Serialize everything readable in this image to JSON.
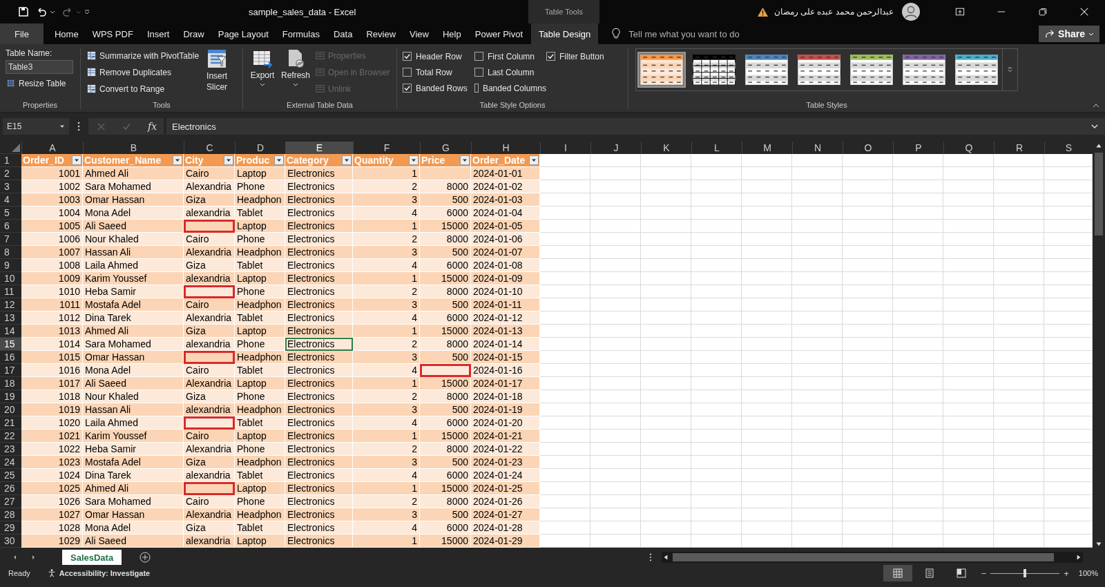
{
  "window": {
    "title": "sample_sales_data  -  Excel",
    "context_label": "Table Tools",
    "user": "عبدالرحمن محمد عبده على رمضان"
  },
  "menu_tabs": [
    {
      "label": "File",
      "selected": false
    },
    {
      "label": "Home",
      "selected": false
    },
    {
      "label": "WPS PDF",
      "selected": false
    },
    {
      "label": "Insert",
      "selected": false
    },
    {
      "label": "Draw",
      "selected": false
    },
    {
      "label": "Page Layout",
      "selected": false
    },
    {
      "label": "Formulas",
      "selected": false
    },
    {
      "label": "Data",
      "selected": false
    },
    {
      "label": "Review",
      "selected": false
    },
    {
      "label": "View",
      "selected": false
    },
    {
      "label": "Help",
      "selected": false
    },
    {
      "label": "Power Pivot",
      "selected": false
    },
    {
      "label": "Table Design",
      "selected": true
    }
  ],
  "tell_me": {
    "placeholder": "Tell me what you want to do"
  },
  "share": "Share",
  "ribbon": {
    "properties": {
      "label": "Table Name:",
      "table_name": "Table3",
      "resize": "Resize Table",
      "group": "Properties"
    },
    "tools": {
      "items": [
        "Summarize with PivotTable",
        "Remove Duplicates",
        "Convert to Range"
      ],
      "slicer": "Insert Slicer",
      "group": "Tools"
    },
    "external": {
      "export": "Export",
      "refresh": "Refresh",
      "items": [
        {
          "label": "Properties",
          "disabled": true
        },
        {
          "label": "Open in Browser",
          "disabled": true
        },
        {
          "label": "Unlink",
          "disabled": true
        }
      ],
      "group": "External Table Data"
    },
    "style_options": {
      "options": [
        {
          "label": "Header Row",
          "checked": true
        },
        {
          "label": "Total Row",
          "checked": false
        },
        {
          "label": "Banded Rows",
          "checked": true
        },
        {
          "label": "First Column",
          "checked": false
        },
        {
          "label": "Last Column",
          "checked": false
        },
        {
          "label": "Banded Columns",
          "checked": false
        },
        {
          "label": "Filter Button",
          "checked": true
        }
      ],
      "group": "Table Style Options"
    },
    "styles": {
      "swatches": [
        {
          "kind": "tinted",
          "color": "#f79646",
          "selected": true
        },
        {
          "kind": "grid",
          "color": "#000000",
          "selected": false
        },
        {
          "kind": "plain",
          "color": "#4f81bd",
          "selected": false
        },
        {
          "kind": "plain",
          "color": "#c0504d",
          "selected": false
        },
        {
          "kind": "plain",
          "color": "#9bbb59",
          "selected": false
        },
        {
          "kind": "plain",
          "color": "#8064a2",
          "selected": false
        },
        {
          "kind": "plain",
          "color": "#4bacc6",
          "selected": false
        }
      ],
      "group": "Table Styles"
    }
  },
  "formula_bar": {
    "name_box": "E15",
    "fx_label": "fx",
    "value": "Electronics"
  },
  "sheet": {
    "columns": [
      {
        "letter": "A",
        "selected": false
      },
      {
        "letter": "B",
        "selected": false
      },
      {
        "letter": "C",
        "selected": false
      },
      {
        "letter": "D",
        "selected": false
      },
      {
        "letter": "E",
        "selected": true
      },
      {
        "letter": "F",
        "selected": false
      },
      {
        "letter": "G",
        "selected": false
      },
      {
        "letter": "H",
        "selected": false
      },
      {
        "letter": "I",
        "selected": false
      },
      {
        "letter": "J",
        "selected": false
      },
      {
        "letter": "K",
        "selected": false
      },
      {
        "letter": "L",
        "selected": false
      },
      {
        "letter": "M",
        "selected": false
      },
      {
        "letter": "N",
        "selected": false
      },
      {
        "letter": "O",
        "selected": false
      },
      {
        "letter": "P",
        "selected": false
      },
      {
        "letter": "Q",
        "selected": false
      },
      {
        "letter": "R",
        "selected": false
      },
      {
        "letter": "S",
        "selected": false
      }
    ],
    "header_row": "1",
    "headers": [
      {
        "label": "Order_ID",
        "kind": "number"
      },
      {
        "label": "Customer_Name",
        "kind": "text"
      },
      {
        "label": "City",
        "kind": "text"
      },
      {
        "label": "Produc",
        "kind": "text"
      },
      {
        "label": "Category",
        "kind": "text"
      },
      {
        "label": "Quantity",
        "kind": "number"
      },
      {
        "label": "Price",
        "kind": "number"
      },
      {
        "label": "Order_Date",
        "kind": "text"
      }
    ],
    "rows": [
      {
        "n": "2",
        "selected": false,
        "cells": [
          "1001",
          "Ahmed Ali",
          "Cairo",
          "Laptop",
          "Electronics",
          "1",
          null,
          "2024-01-01"
        ]
      },
      {
        "n": "3",
        "selected": false,
        "cells": [
          "1002",
          "Sara Mohamed",
          "Alexandria",
          "Phone",
          "Electronics",
          "2",
          "8000",
          "2024-01-02"
        ]
      },
      {
        "n": "4",
        "selected": false,
        "cells": [
          "1003",
          "Omar Hassan",
          "Giza",
          "Headphon",
          "Electronics",
          "3",
          "500",
          "2024-01-03"
        ]
      },
      {
        "n": "5",
        "selected": false,
        "cells": [
          "1004",
          "Mona Adel",
          "alexandria",
          "Tablet",
          "Electronics",
          "4",
          "6000",
          "2024-01-04"
        ]
      },
      {
        "n": "6",
        "selected": false,
        "cells": [
          "1005",
          "Ali Saeed",
          {
            "flagged": true
          },
          "Laptop",
          "Electronics",
          "1",
          "15000",
          "2024-01-05"
        ]
      },
      {
        "n": "7",
        "selected": false,
        "cells": [
          "1006",
          "Nour Khaled",
          "Cairo",
          "Phone",
          "Electronics",
          "2",
          "8000",
          "2024-01-06"
        ]
      },
      {
        "n": "8",
        "selected": false,
        "cells": [
          "1007",
          "Hassan Ali",
          "Alexandria",
          "Headphon",
          "Electronics",
          "3",
          "500",
          "2024-01-07"
        ]
      },
      {
        "n": "9",
        "selected": false,
        "cells": [
          "1008",
          "Laila Ahmed",
          "Giza",
          "Tablet",
          "Electronics",
          "4",
          "6000",
          "2024-01-08"
        ]
      },
      {
        "n": "10",
        "selected": false,
        "cells": [
          "1009",
          "Karim Youssef",
          "alexandria",
          "Laptop",
          "Electronics",
          "1",
          "15000",
          "2024-01-09"
        ]
      },
      {
        "n": "11",
        "selected": false,
        "cells": [
          "1010",
          "Heba Samir",
          {
            "flagged": true
          },
          "Phone",
          "Electronics",
          "2",
          "8000",
          "2024-01-10"
        ]
      },
      {
        "n": "12",
        "selected": false,
        "cells": [
          "1011",
          "Mostafa Adel",
          "Cairo",
          "Headphon",
          "Electronics",
          "3",
          "500",
          "2024-01-11"
        ]
      },
      {
        "n": "13",
        "selected": false,
        "cells": [
          "1012",
          "Dina Tarek",
          "Alexandria",
          "Tablet",
          "Electronics",
          "4",
          "6000",
          "2024-01-12"
        ]
      },
      {
        "n": "14",
        "selected": false,
        "cells": [
          "1013",
          "Ahmed Ali",
          "Giza",
          "Laptop",
          "Electronics",
          "1",
          "15000",
          "2024-01-13"
        ]
      },
      {
        "n": "15",
        "selected": true,
        "cells": [
          "1014",
          "Sara Mohamed",
          "alexandria",
          "Phone",
          "Electronics",
          "2",
          "8000",
          "2024-01-14"
        ]
      },
      {
        "n": "16",
        "selected": false,
        "cells": [
          "1015",
          "Omar Hassan",
          {
            "flagged": true
          },
          "Headphon",
          "Electronics",
          "3",
          "500",
          "2024-01-15"
        ]
      },
      {
        "n": "17",
        "selected": false,
        "cells": [
          "1016",
          "Mona Adel",
          "Cairo",
          "Tablet",
          "Electronics",
          "4",
          {
            "flagged": true
          },
          "2024-01-16"
        ]
      },
      {
        "n": "18",
        "selected": false,
        "cells": [
          "1017",
          "Ali Saeed",
          "Alexandria",
          "Laptop",
          "Electronics",
          "1",
          "15000",
          "2024-01-17"
        ]
      },
      {
        "n": "19",
        "selected": false,
        "cells": [
          "1018",
          "Nour Khaled",
          "Giza",
          "Phone",
          "Electronics",
          "2",
          "8000",
          "2024-01-18"
        ]
      },
      {
        "n": "20",
        "selected": false,
        "cells": [
          "1019",
          "Hassan Ali",
          "alexandria",
          "Headphon",
          "Electronics",
          "3",
          "500",
          "2024-01-19"
        ]
      },
      {
        "n": "21",
        "selected": false,
        "cells": [
          "1020",
          "Laila Ahmed",
          {
            "flagged": true
          },
          "Tablet",
          "Electronics",
          "4",
          "6000",
          "2024-01-20"
        ]
      },
      {
        "n": "22",
        "selected": false,
        "cells": [
          "1021",
          "Karim Youssef",
          "Cairo",
          "Laptop",
          "Electronics",
          "1",
          "15000",
          "2024-01-21"
        ]
      },
      {
        "n": "23",
        "selected": false,
        "cells": [
          "1022",
          "Heba Samir",
          "Alexandria",
          "Phone",
          "Electronics",
          "2",
          "8000",
          "2024-01-22"
        ]
      },
      {
        "n": "24",
        "selected": false,
        "cells": [
          "1023",
          "Mostafa Adel",
          "Giza",
          "Headphon",
          "Electronics",
          "3",
          "500",
          "2024-01-23"
        ]
      },
      {
        "n": "25",
        "selected": false,
        "cells": [
          "1024",
          "Dina Tarek",
          "alexandria",
          "Tablet",
          "Electronics",
          "4",
          "6000",
          "2024-01-24"
        ]
      },
      {
        "n": "26",
        "selected": false,
        "cells": [
          "1025",
          "Ahmed Ali",
          {
            "flagged": true
          },
          "Laptop",
          "Electronics",
          "1",
          "15000",
          "2024-01-25"
        ]
      },
      {
        "n": "27",
        "selected": false,
        "cells": [
          "1026",
          "Sara Mohamed",
          "Cairo",
          "Phone",
          "Electronics",
          "2",
          "8000",
          "2024-01-26"
        ]
      },
      {
        "n": "28",
        "selected": false,
        "cells": [
          "1027",
          "Omar Hassan",
          "Alexandria",
          "Headphon",
          "Electronics",
          "3",
          "500",
          "2024-01-27"
        ]
      },
      {
        "n": "29",
        "selected": false,
        "cells": [
          "1028",
          "Mona Adel",
          "Giza",
          "Tablet",
          "Electronics",
          "4",
          "6000",
          "2024-01-28"
        ]
      },
      {
        "n": "30",
        "selected": false,
        "cells": [
          "1029",
          "Ali Saeed",
          "alexandria",
          "Laptop",
          "Electronics",
          "1",
          "15000",
          "2024-01-29"
        ]
      }
    ]
  },
  "sheet_tabs": [
    {
      "label": "SalesData",
      "selected": true
    }
  ],
  "status_bar": {
    "ready": "Ready",
    "accessibility": "Accessibility: Investigate",
    "views": [
      {
        "kind": "normal",
        "selected": true
      },
      {
        "kind": "page-layout",
        "selected": false
      },
      {
        "kind": "page-break",
        "selected": false
      }
    ],
    "zoom_out": "−",
    "zoom_slider": {
      "level": 0.5
    },
    "zoom_in": "+",
    "zoom": "100%"
  }
}
